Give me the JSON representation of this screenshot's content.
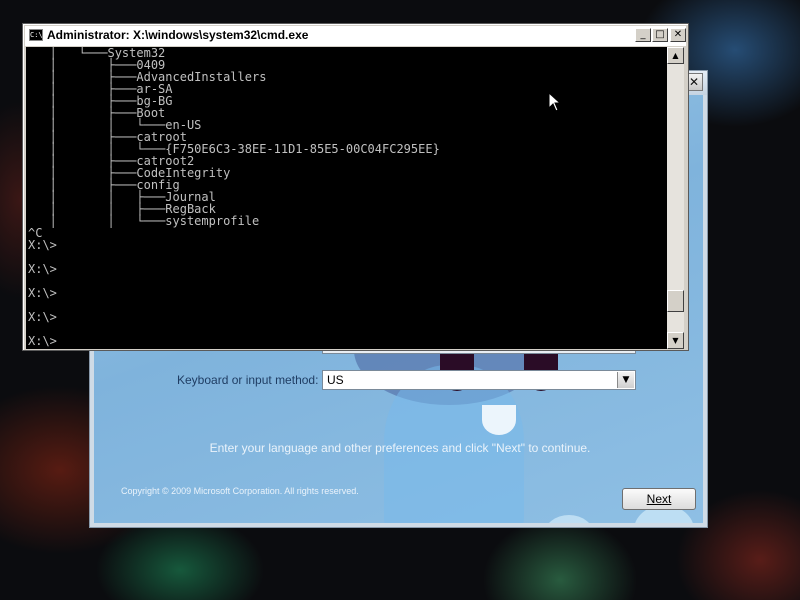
{
  "setup_window": {
    "close_glyph": "✕",
    "keyboard_label": "Keyboard or input method:",
    "keyboard_value": "US",
    "instruction": "Enter your language and other preferences and click \"Next\" to continue.",
    "copyright": "Copyright © 2009 Microsoft Corporation. All rights reserved.",
    "next_label": "Next"
  },
  "cmd_window": {
    "title": "Administrator: X:\\windows\\system32\\cmd.exe",
    "icon_text": "C:\\",
    "buttons": {
      "minimize": "_",
      "maximize": "□",
      "close": "✕"
    },
    "console_lines": [
      "   │   └───System32",
      "   │       ├───0409",
      "   │       ├───AdvancedInstallers",
      "   │       ├───ar-SA",
      "   │       ├───bg-BG",
      "   │       ├───Boot",
      "   │       │   └───en-US",
      "   │       ├───catroot",
      "   │       │   └───{F750E6C3-38EE-11D1-85E5-00C04FC295EE}",
      "   │       ├───catroot2",
      "   │       ├───CodeIntegrity",
      "   │       ├───config",
      "   │       │   ├───Journal",
      "   │       │   ├───RegBack",
      "   │       │   └───systemprofile",
      "^C",
      "X:\\>",
      "",
      "X:\\>",
      "",
      "X:\\>",
      "",
      "X:\\>",
      "",
      "X:\\>"
    ],
    "scroll_up": "▲",
    "scroll_down": "▼"
  }
}
